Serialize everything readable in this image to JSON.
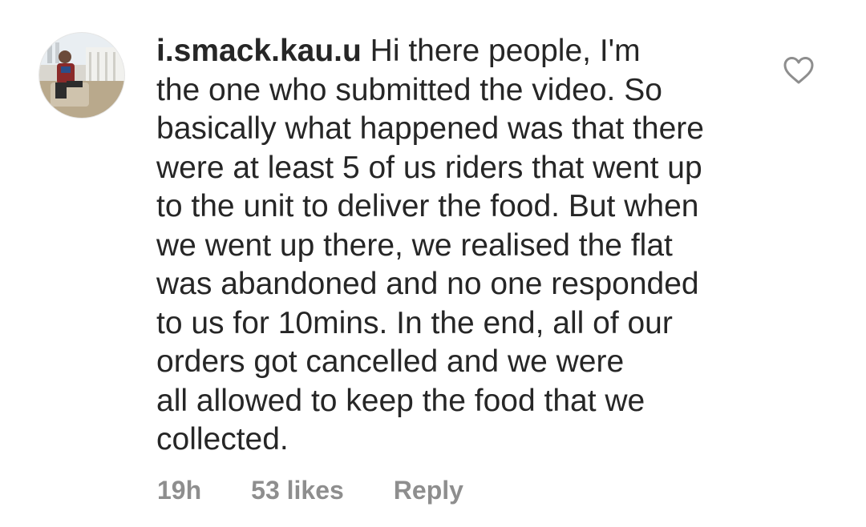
{
  "comment": {
    "username": "i.smack.kau.u",
    "lines": [
      "Hi there people, I'm",
      "the one who submitted the video. So",
      "basically what happened was that there",
      "were at least 5 of us riders that went up",
      "to the unit to deliver the food. But when",
      "we went up there, we realised the flat",
      "was abandoned and no one responded",
      "to us for 10mins. In the end, all of our",
      "orders got cancelled and we were",
      "all allowed to keep the food that we",
      "collected."
    ],
    "time_ago": "19h",
    "likes": "53 likes",
    "reply_label": "Reply",
    "like_icon": "heart-outline-icon"
  },
  "colors": {
    "text": "#262626",
    "meta": "#8e8e8e",
    "icon": "#8e8e8e"
  }
}
